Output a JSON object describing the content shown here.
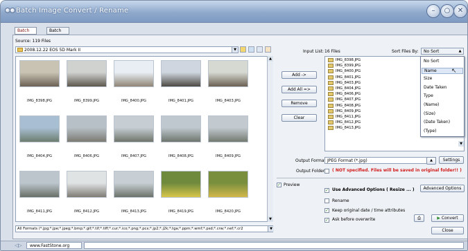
{
  "window": {
    "title": "Batch Image Convert / Rename"
  },
  "tabs": [
    {
      "label": "Batch Convert"
    },
    {
      "label": "Batch Rename"
    }
  ],
  "source": {
    "label": "Source: 119 Files",
    "folder": "2008.12.22 EOS 5D Mark II"
  },
  "thumbnails": [
    {
      "name": "IMG_8398.JPG",
      "colors": [
        "#c9c3b4",
        "#6b6254"
      ]
    },
    {
      "name": "IMG_8399.JPG",
      "colors": [
        "#d0d2d0",
        "#5e584e"
      ]
    },
    {
      "name": "IMG_8400.JPG",
      "colors": [
        "#e8eef4",
        "#8f8576"
      ]
    },
    {
      "name": "IMG_8401.JPG",
      "colors": [
        "#cfd6df",
        "#4d4a44"
      ]
    },
    {
      "name": "IMG_8403.JPG",
      "colors": [
        "#d6d8d2",
        "#6a6052"
      ]
    },
    {
      "name": "IMG_8404.JPG",
      "colors": [
        "#a8bfd3",
        "#6d7e70"
      ]
    },
    {
      "name": "IMG_8406.JPG",
      "colors": [
        "#b7c0c6",
        "#7c7a73"
      ]
    },
    {
      "name": "IMG_8407.JPG",
      "colors": [
        "#c6cdd3",
        "#6f756b"
      ]
    },
    {
      "name": "IMG_8408.JPG",
      "colors": [
        "#bfc8cf",
        "#6f756e"
      ]
    },
    {
      "name": "IMG_8409.JPG",
      "colors": [
        "#c2c9cf",
        "#737a71"
      ]
    },
    {
      "name": "IMG_8411.JPG",
      "colors": [
        "#bcc5cc",
        "#697068"
      ]
    },
    {
      "name": "IMG_8412.JPG",
      "colors": [
        "#e0e3e4",
        "#7e7b74"
      ]
    },
    {
      "name": "IMG_8413.JPG",
      "colors": [
        "#c7cfd4",
        "#6c736b"
      ]
    },
    {
      "name": "IMG_8419.JPG",
      "colors": [
        "#6f8a3d",
        "#d8c64a"
      ]
    },
    {
      "name": "IMG_8420.JPG",
      "colors": [
        "#7a8f3e",
        "#d2b84a"
      ]
    }
  ],
  "formats": {
    "text": "All Formats (*.jpg;*.jpe;*.jpeg;*.bmp;*.gif;*.tif;*.tiff;*.cur;*.ico;*.png;*.pcx;*.jp2;*.j2k;*.tga;*.ppm;*.wmf;*.psd;*.crw;*.nef;*.cr2"
  },
  "input": {
    "label": "Input List:",
    "count": "16 Files",
    "files": [
      "IMG_8398.JPG",
      "IMG_8399.JPG",
      "IMG_8400.JPG",
      "IMG_8401.JPG",
      "IMG_8403.JPG",
      "IMG_8404.JPG",
      "IMG_8406.JPG",
      "IMG_8407.JPG",
      "IMG_8408.JPG",
      "IMG_8409.JPG",
      "IMG_8411.JPG",
      "IMG_8412.JPG",
      "IMG_8413.JPG"
    ]
  },
  "buttons": {
    "add": "Add ->",
    "add_all": "Add All =>",
    "remove": "Remove",
    "clear": "Clear",
    "settings": "Settings",
    "advanced_options": "Advanced Options",
    "convert": "Convert",
    "close": "Close"
  },
  "sort": {
    "label": "Sort Files By:",
    "selected": "No Sort",
    "options": [
      "No Sort",
      "Name",
      "Size",
      "Date Taken",
      "Type",
      "(Name)",
      "(Size)",
      "(Date Taken)",
      "(Type)"
    ],
    "highlighted_index": 1
  },
  "output": {
    "format_label": "Output Format:",
    "format_value": "JPEG Format (*.jpg)",
    "folder_label": "Output Folder:",
    "folder_warning": "( NOT specified. Files will be saved in original folder!! )"
  },
  "options": {
    "preview": "Preview",
    "advanced": "Use Advanced Options ( Resize ... )",
    "rename": "Rename",
    "keep_date": "Keep original date / time attributes",
    "ask_overwrite": "Ask before overwrite"
  },
  "statusbar": {
    "url": "www.FastStone.org"
  },
  "colors": {
    "accent": "#5a78a6",
    "warning": "#d11b1b"
  }
}
